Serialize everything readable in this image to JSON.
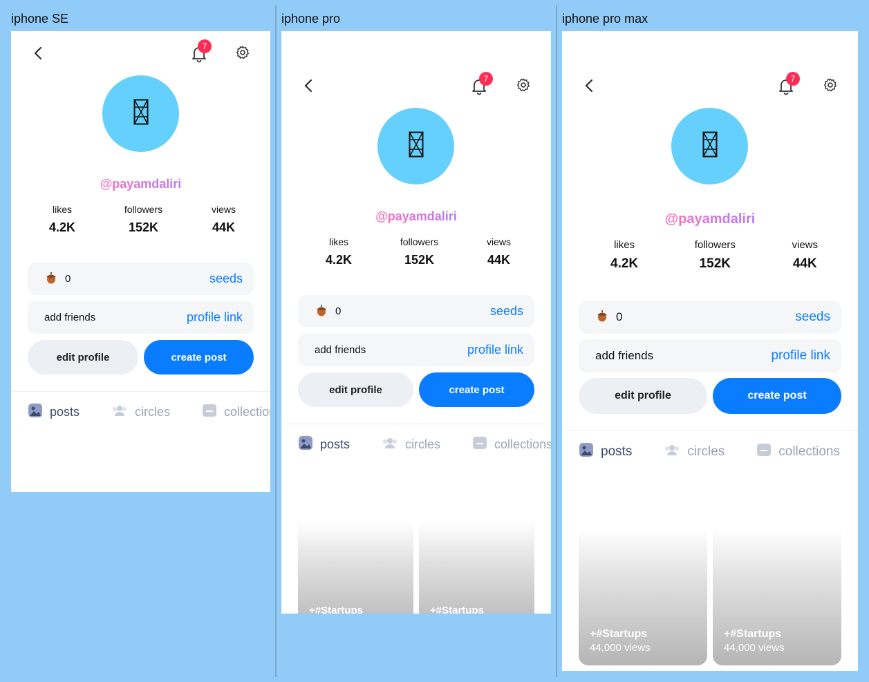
{
  "frames": [
    {
      "label": "iphone SE",
      "handle": "@payamdaliri",
      "notification_count": "7",
      "stats": [
        {
          "label": "likes",
          "value": "4.2K"
        },
        {
          "label": "followers",
          "value": "152K"
        },
        {
          "label": "views",
          "value": "44K"
        }
      ],
      "seeds_count": "0",
      "seeds_link": "seeds",
      "add_friends": "add friends",
      "profile_link": "profile link",
      "edit_profile": "edit profile",
      "create_post": "create post",
      "tabs": [
        "posts",
        "circles",
        "collections"
      ]
    },
    {
      "label": "iphone pro",
      "handle": "@payamdaliri",
      "notification_count": "7",
      "stats": [
        {
          "label": "likes",
          "value": "4.2K"
        },
        {
          "label": "followers",
          "value": "152K"
        },
        {
          "label": "views",
          "value": "44K"
        }
      ],
      "seeds_count": "0",
      "seeds_link": "seeds",
      "add_friends": "add friends",
      "profile_link": "profile link",
      "edit_profile": "edit profile",
      "create_post": "create post",
      "tabs": [
        "posts",
        "circles",
        "collections"
      ],
      "posts": [
        {
          "tag": "+#Startups"
        },
        {
          "tag": "+#Startups"
        }
      ]
    },
    {
      "label": "iphone pro max",
      "handle": "@payamdaliri",
      "notification_count": "7",
      "stats": [
        {
          "label": "likes",
          "value": "4.2K"
        },
        {
          "label": "followers",
          "value": "152K"
        },
        {
          "label": "views",
          "value": "44K"
        }
      ],
      "seeds_count": "0",
      "seeds_link": "seeds",
      "add_friends": "add friends",
      "profile_link": "profile link",
      "edit_profile": "edit profile",
      "create_post": "create post",
      "tabs": [
        "posts",
        "circles",
        "collections"
      ],
      "posts": [
        {
          "tag": "+#Startups",
          "views": "44,000 views"
        },
        {
          "tag": "+#Startups",
          "views": "44,000 views"
        }
      ]
    }
  ],
  "colors": {
    "canvas": "#91cbf7",
    "accent": "#0a7cff",
    "avatar": "#66d0fc",
    "badge": "#ff2d55"
  },
  "icons": [
    "back-chevron-icon",
    "bell-icon",
    "gear-icon",
    "avatar-placeholder-icon",
    "acorn-icon",
    "posts-image-icon",
    "circles-people-icon",
    "collections-folder-icon"
  ]
}
